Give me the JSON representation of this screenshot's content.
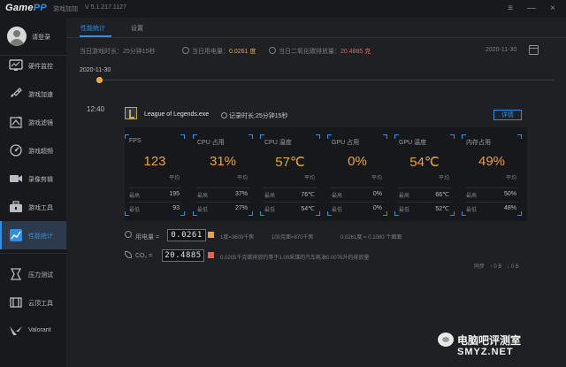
{
  "titlebar": {
    "logo_game": "Game",
    "logo_pp": "PP",
    "title": "游戏加加",
    "version": "V 5.1.217.1127",
    "menu_glyph": "≡",
    "minimize_glyph": "—",
    "close_glyph": "×"
  },
  "sidebar": {
    "login_label": "请登录",
    "items": [
      {
        "label": "硬件监控",
        "icon": "monitor-icon"
      },
      {
        "label": "游戏加速",
        "icon": "rocket-icon"
      },
      {
        "label": "游戏滤镜",
        "icon": "filter-icon"
      },
      {
        "label": "游戏超频",
        "icon": "gauge-icon"
      },
      {
        "label": "录像剪辑",
        "icon": "video-icon"
      },
      {
        "label": "游戏工具",
        "icon": "toolbox-icon"
      },
      {
        "label": "性能统计",
        "icon": "chart-icon",
        "active": true
      },
      {
        "label": "压力测试",
        "icon": "stress-icon"
      },
      {
        "label": "云顶工具",
        "icon": "cloud-tool-icon"
      },
      {
        "label": "Valorant",
        "icon": "valorant-icon"
      }
    ]
  },
  "tabs": {
    "performance": "性能统计",
    "settings": "设置"
  },
  "summary": {
    "play_time_label": "当日游戏时长：",
    "play_time_value": "25分钟15秒",
    "power_label": "当日用电量：",
    "power_value": "0.0261 度",
    "co2_label": "当日二氧化碳排放量：",
    "co2_value": "20.4885 克",
    "date": "2020-11-30"
  },
  "timeline": {
    "date": "2020-11-30"
  },
  "session": {
    "time": "12:40",
    "game_name": "League of Legends.exe",
    "record_duration": "记录时长:25分钟15秒",
    "details_label": "详情"
  },
  "cards": [
    {
      "title": "FPS",
      "value": "123",
      "avg": "平均",
      "max_label": "最高",
      "max": "195",
      "min_label": "最低",
      "min": "93"
    },
    {
      "title": "CPU 占用",
      "value": "31%",
      "avg": "平均",
      "max_label": "最高",
      "max": "37%",
      "min_label": "最低",
      "min": "27%"
    },
    {
      "title": "CPU 温度",
      "value": "57℃",
      "avg": "平均",
      "max_label": "最高",
      "max": "76℃",
      "min_label": "最低",
      "min": "54℃"
    },
    {
      "title": "GPU 占用",
      "value": "0%",
      "avg": "平均",
      "max_label": "最高",
      "max": "0%",
      "min_label": "最低",
      "min": "0%"
    },
    {
      "title": "GPU 温度",
      "value": "54℃",
      "avg": "平均",
      "max_label": "最高",
      "max": "66℃",
      "min_label": "最低",
      "min": "52℃"
    },
    {
      "title": "内存占用",
      "value": "49%",
      "avg": "平均",
      "max_label": "最高",
      "max": "50%",
      "min_label": "最低",
      "min": "48%"
    }
  ],
  "power": {
    "label": "用电量 =",
    "readout": "0.0261",
    "note1": "1度=3600千焦",
    "note2": "100克面=870千焦",
    "note3": "0.0261度 = 0.1080 个面面"
  },
  "co2": {
    "label": "CO₂ =",
    "readout": "20.4885",
    "note": "0.0205千克碳排放约等于1.00采煤的汽车耗油0.0076升的排放量"
  },
  "sync": {
    "label": "同步",
    "up": "↑ 0 B",
    "down": "↓ 0 B"
  },
  "watermark": {
    "line1": "电脑吧评测室",
    "line2": "SMYZ.NET"
  },
  "colors": {
    "accent_blue": "#2f8fe6",
    "value_orange": "#e8a43a",
    "co2_red": "#e8634a",
    "background": "#1f2024",
    "sidebar": "#18191c"
  }
}
